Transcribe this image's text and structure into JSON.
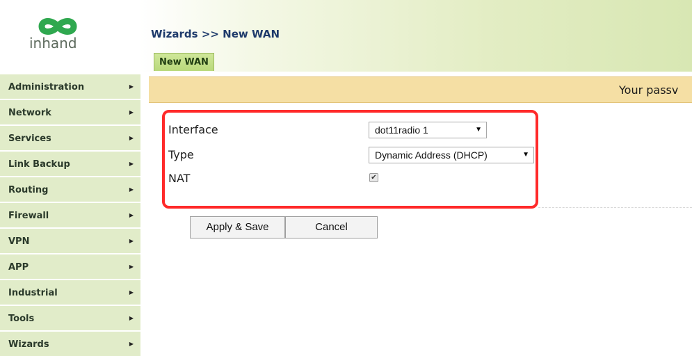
{
  "brand": {
    "name": "inhand",
    "accent_color": "#2fa84f"
  },
  "header": {
    "title": "Wizards >> New WAN",
    "tab_label": "New WAN"
  },
  "sidebar": {
    "items": [
      {
        "label": "Administration"
      },
      {
        "label": "Network"
      },
      {
        "label": "Services"
      },
      {
        "label": "Link Backup"
      },
      {
        "label": "Routing"
      },
      {
        "label": "Firewall"
      },
      {
        "label": "VPN"
      },
      {
        "label": "APP"
      },
      {
        "label": "Industrial"
      },
      {
        "label": "Tools"
      },
      {
        "label": "Wizards"
      }
    ],
    "arrow_icon": "triangle-right-icon"
  },
  "notice": {
    "text": "Your passv"
  },
  "form": {
    "interface_label": "Interface",
    "interface_value": "dot11radio 1",
    "type_label": "Type",
    "type_value": "Dynamic Address (DHCP)",
    "nat_label": "NAT",
    "nat_checked": true,
    "highlight_color": "#ff2a2a"
  },
  "actions": {
    "apply_label": "Apply & Save",
    "cancel_label": "Cancel"
  }
}
